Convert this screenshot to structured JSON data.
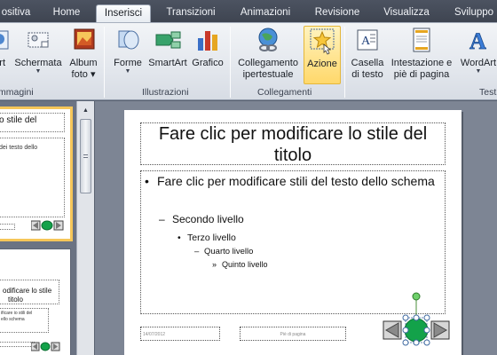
{
  "tabs": [
    "ositiva",
    "Home",
    "Inserisci",
    "Transizioni",
    "Animazioni",
    "Revisione",
    "Visualizza",
    "Sviluppo"
  ],
  "ribbon": {
    "buttons": {
      "art": "Art",
      "schermata": "Schermata",
      "album": "Album",
      "album2": "foto",
      "forme": "Forme",
      "smartart": "SmartArt",
      "grafico": "Grafico",
      "collegamento": "Collegamento",
      "collegamento2": "ipertestuale",
      "azione": "Azione",
      "casella": "Casella",
      "casella2": "di testo",
      "intestazione": "Intestazione e",
      "intestazione2": "piè di pagina",
      "wordart": "WordArt"
    },
    "groups": {
      "immagini": "mmagini",
      "illustrazioni": "Illustrazioni",
      "collegamenti": "Collegamenti",
      "testo": "Test"
    }
  },
  "slide": {
    "title": "Fare clic per modificare lo stile del titolo",
    "level1": "Fare clic per modificare stili del testo dello schema",
    "level2": "Secondo livello",
    "level3": "Terzo livello",
    "level4": "Quarto livello",
    "level5": "Quinto livello",
    "date": "14/07/2012",
    "footer": "Piè di pagina"
  },
  "thumbs": {
    "t1_title": "o stile del",
    "t1_body": "dei testo dello",
    "t2_title": "odificare lo stile",
    "t2_title2": "titolo",
    "t2_body": "ificare io stili del",
    "t2_body2": "ello schema"
  },
  "colors": {
    "accent_action": "#ffd86b",
    "nav_green": "#13a24a",
    "tabs_bg": "#4c5361"
  }
}
